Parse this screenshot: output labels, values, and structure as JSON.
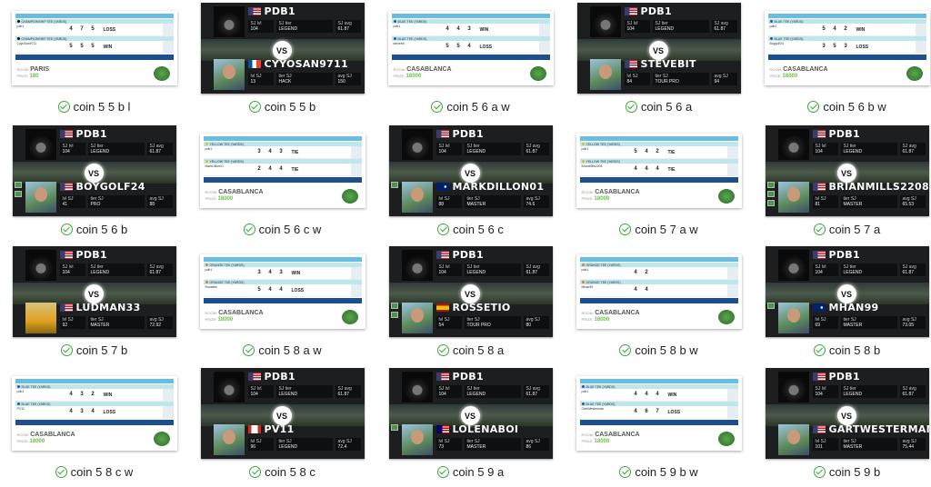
{
  "accent": "#3aa83a",
  "me": {
    "name": "PDB1",
    "flag": "us",
    "lvl_label": "SJ lvl",
    "tier_label": "SJ tier",
    "avg_label": "SJ avg",
    "lvl": "104",
    "tier": "LEGEND",
    "avg": "61.87"
  },
  "opp_labels": {
    "lvl": "lvl SJ",
    "tier": "tier SJ",
    "avg": "avg SJ"
  },
  "vs_text": "VS",
  "room_label": "ROOM:",
  "prize_label": "PRIZE:",
  "items": [
    {
      "label": "coin 5 5 b l",
      "type": "score",
      "tee": "CHAMPIONSHIP TEE (YARDS)",
      "tee_color": "#111",
      "room": "PARIS",
      "prize": "180",
      "p1": "pdb1",
      "s1": [
        "4",
        "7",
        "5"
      ],
      "r1": "LOSS",
      "p2": "CyyoSan9711",
      "s2": [
        "5",
        "5",
        "5"
      ],
      "r2": "WIN"
    },
    {
      "label": "coin 5 5 b",
      "type": "vs",
      "name": "CYYOSAN9711",
      "flag": "fr",
      "lvl": "13",
      "tier": "HACK",
      "avg": "150",
      "avatar": "photo"
    },
    {
      "label": "coin 5 6 a w",
      "type": "score",
      "tee": "BLUE TEE (YARDS)",
      "tee_color": "#1e5aa8",
      "room": "CASABLANCA",
      "prize": "18000",
      "p1": "pdb1",
      "s1": [
        "4",
        "4",
        "3"
      ],
      "r1": "WIN",
      "p2": "stevebit",
      "s2": [
        "5",
        "5",
        "4"
      ],
      "r2": "LOSS"
    },
    {
      "label": "coin 5 6 a",
      "type": "vs",
      "name": "STEVEBIT",
      "flag": "us",
      "lvl": "84",
      "tier": "TOUR PRO",
      "avg": "94",
      "avatar": "photo"
    },
    {
      "label": "coin 5 6 b w",
      "type": "score",
      "tee": "BLUE TEE (YARDS)",
      "tee_color": "#1e5aa8",
      "room": "CASABLANCA",
      "prize": "18000",
      "p1": "pdb1",
      "s1": [
        "5",
        "4",
        "2"
      ],
      "r1": "WIN",
      "p2": "Boygolf24",
      "s2": [
        "3",
        "5",
        "3"
      ],
      "r2": "LOSS"
    },
    {
      "label": "coin 5 6 b",
      "type": "vs",
      "name": "BOYGOLF24",
      "flag": "us",
      "lvl": "41",
      "tier": "PRO",
      "avg": "88",
      "avatar": "photo",
      "badges": 2
    },
    {
      "label": "coin 5 6 c w",
      "type": "score",
      "tee": "YELLOW TEE (YARDS)",
      "tee_color": "#e0c020",
      "room": "CASABLANCA",
      "prize": "18000",
      "p1": "pdb1",
      "s1": [
        "3",
        "4",
        "3"
      ],
      "r1": "TIE",
      "p2": "MarkDillon01",
      "s2": [
        "2",
        "4",
        "4"
      ],
      "r2": "TIE"
    },
    {
      "label": "coin 5 6 c",
      "type": "vs",
      "name": "MARKDILLON01",
      "flag": "au",
      "lvl": "88",
      "tier": "MASTER",
      "avg": "74.6",
      "avatar": "photo",
      "badges": 1
    },
    {
      "label": "coin 5 7 a w",
      "type": "score",
      "tee": "YELLOW TEE (YARDS)",
      "tee_color": "#e0c020",
      "room": "CASABLANCA",
      "prize": "18000",
      "p1": "pdb1",
      "s1": [
        "5",
        "4",
        "2"
      ],
      "r1": "TIE",
      "p2": "BrianMills2208",
      "s2": [
        "4",
        "4",
        "4"
      ],
      "r2": "TIE"
    },
    {
      "label": "coin 5 7 a",
      "type": "vs",
      "name": "BRIANMILLS2208",
      "flag": "us",
      "lvl": "81",
      "tier": "MASTER",
      "avg": "65.53",
      "avatar": "photo",
      "badges": 3
    },
    {
      "label": "coin 5 7 b",
      "type": "vs",
      "name": "LUDMAN33",
      "flag": "us",
      "lvl": "92",
      "tier": "MASTER",
      "avg": "72.92",
      "avatar": "gold"
    },
    {
      "label": "coin 5 8 a w",
      "type": "score",
      "tee": "ORANGE TEE (YARDS)",
      "tee_color": "#e08020",
      "room": "CASABLANCA",
      "prize": "18000",
      "p1": "pdb1",
      "s1": [
        "3",
        "4",
        "3"
      ],
      "r1": "WIN",
      "p2": "Rossetio",
      "s2": [
        "5",
        "4",
        "4"
      ],
      "r2": "LOSS"
    },
    {
      "label": "coin 5 8 a",
      "type": "vs",
      "name": "ROSSETIO",
      "flag": "es",
      "lvl": "54",
      "tier": "TOUR PRO",
      "avg": "80",
      "avatar": "photo",
      "badges": 2
    },
    {
      "label": "coin 5 8 b w",
      "type": "score",
      "tee": "ORANGE TEE (YARDS)",
      "tee_color": "#e08020",
      "room": "CASABLANCA",
      "prize": "18000",
      "p1": "pdb1",
      "s1": [
        "4",
        "2",
        ""
      ],
      "r1": "",
      "p2": "Mhan99",
      "s2": [
        "4",
        "4",
        ""
      ],
      "r2": ""
    },
    {
      "label": "coin 5 8 b",
      "type": "vs",
      "name": "MHAN99",
      "flag": "au",
      "lvl": "69",
      "tier": "MASTER",
      "avg": "73.05",
      "avatar": "photo",
      "badges": 1
    },
    {
      "label": "coin 5 8 c w",
      "type": "score",
      "tee": "BLUE TEE (YARDS)",
      "tee_color": "#1e5aa8",
      "room": "CASABLANCA",
      "prize": "18000",
      "p1": "pdb1",
      "s1": [
        "4",
        "3",
        "2"
      ],
      "r1": "WIN",
      "p2": "PV11",
      "s2": [
        "4",
        "3",
        "4"
      ],
      "r2": "LOSS"
    },
    {
      "label": "coin 5 8 c",
      "type": "vs",
      "name": "PV11",
      "flag": "ca",
      "lvl": "96",
      "tier": "LEGEND",
      "avg": "72.4",
      "avatar": "photo"
    },
    {
      "label": "coin 5 9 a",
      "type": "vs",
      "name": "LOLENABOI",
      "flag": "my",
      "lvl": "73",
      "tier": "MASTER",
      "avg": "86",
      "avatar": "photo",
      "badges": 1
    },
    {
      "label": "coin 5 9 b w",
      "type": "score",
      "tee": "BLUE TEE (YARDS)",
      "tee_color": "#1e5aa8",
      "room": "CASABLANCA",
      "prize": "18000",
      "p1": "pdb1",
      "s1": [
        "4",
        "4",
        "4"
      ],
      "r1": "WIN",
      "p2": "GartWesterman",
      "s2": [
        "4",
        "6",
        "7"
      ],
      "r2": "LOSS"
    },
    {
      "label": "coin 5 9 b",
      "type": "vs",
      "name": "GARTWESTERMAN",
      "flag": "us",
      "lvl": "101",
      "tier": "MASTER",
      "avg": "75.44",
      "avatar": "photo"
    }
  ]
}
